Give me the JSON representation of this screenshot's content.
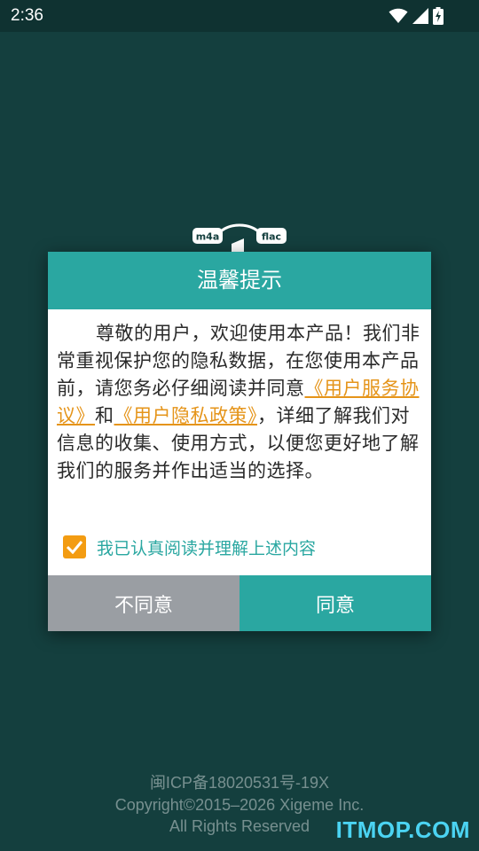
{
  "status_bar": {
    "time": "2:36"
  },
  "logo": {
    "left_badge": "m4a",
    "right_badge": "flac"
  },
  "dialog": {
    "title": "温馨提示",
    "message": {
      "part1": "尊敬的用户，欢迎使用本产品！我们非常重视保护您的隐私数据，在您使用本产品前，请您务必仔细阅读并同意",
      "link1": "《用户服务协议》",
      "part2": "和",
      "link2": "《用户隐私政策》",
      "part3": "，详细了解我们对信息的收集、使用方式，以便您更好地了解我们的服务并作出适当的选择。"
    },
    "checkbox_label": "我已认真阅读并理解上述内容",
    "checkbox_checked": true,
    "disagree_label": "不同意",
    "agree_label": "同意"
  },
  "footer": {
    "icp": "闽ICP备18020531号-19X",
    "copyright": "Copyright©2015–2026 Xigeme Inc.",
    "rights": "All Rights Reserved"
  },
  "watermark": "ITMOP.COM",
  "colors": {
    "teal": "#2aa7a1",
    "background": "#143f3e",
    "link": "#e59419",
    "checkbox": "#f39c12",
    "disagree": "#9a9ea3"
  }
}
